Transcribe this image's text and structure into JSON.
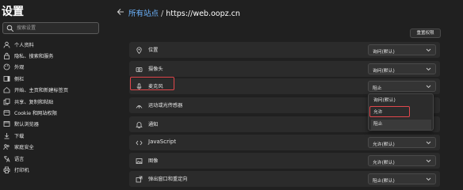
{
  "app": {
    "title": "设置"
  },
  "search": {
    "placeholder": "搜索设置"
  },
  "sidebar": {
    "items": [
      {
        "label": "个人资料",
        "icon": "person-icon"
      },
      {
        "label": "隐私、搜索和服务",
        "icon": "lock-icon"
      },
      {
        "label": "外观",
        "icon": "appearance-icon"
      },
      {
        "label": "侧栏",
        "icon": "sidebar-icon"
      },
      {
        "label": "开始、主页和新建标签页",
        "icon": "home-icon"
      },
      {
        "label": "共享、复制和粘贴",
        "icon": "share-icon"
      },
      {
        "label": "Cookie 和网站权限",
        "icon": "cookie-icon"
      },
      {
        "label": "默认浏览器",
        "icon": "browser-icon"
      },
      {
        "label": "下载",
        "icon": "download-icon"
      },
      {
        "label": "家庭安全",
        "icon": "family-icon"
      },
      {
        "label": "语言",
        "icon": "language-icon"
      },
      {
        "label": "打印机",
        "icon": "printer-icon"
      }
    ]
  },
  "breadcrumb": {
    "parent": "所有站点",
    "separator": " / ",
    "current": "https://web.oopz.cn"
  },
  "actions": {
    "reset_label": "重置权限"
  },
  "permissions": [
    {
      "label": "位置",
      "value": "询问(默认)",
      "icon": "location-icon"
    },
    {
      "label": "摄像头",
      "value": "询问(默认)",
      "icon": "camera-icon"
    },
    {
      "label": "麦克风",
      "value": "阻止",
      "icon": "microphone-icon"
    },
    {
      "label": "运动或光传感器",
      "value": "",
      "icon": "sensor-icon"
    },
    {
      "label": "通知",
      "value": "",
      "icon": "bell-icon"
    },
    {
      "label": "JavaScript",
      "value": "允许(默认)",
      "icon": "code-icon"
    },
    {
      "label": "图像",
      "value": "允许(默认)",
      "icon": "image-icon"
    },
    {
      "label": "弹出窗口和重定向",
      "value": "阻止(默认)",
      "icon": "popup-icon"
    }
  ],
  "dropdown": {
    "options": [
      "询问(默认)",
      "允许",
      "阻止"
    ],
    "selected": "阻止"
  },
  "colors": {
    "accent_link": "#6cb4ff",
    "highlight": "#e0474c",
    "background": "#202020",
    "row": "#2b2b2b"
  }
}
